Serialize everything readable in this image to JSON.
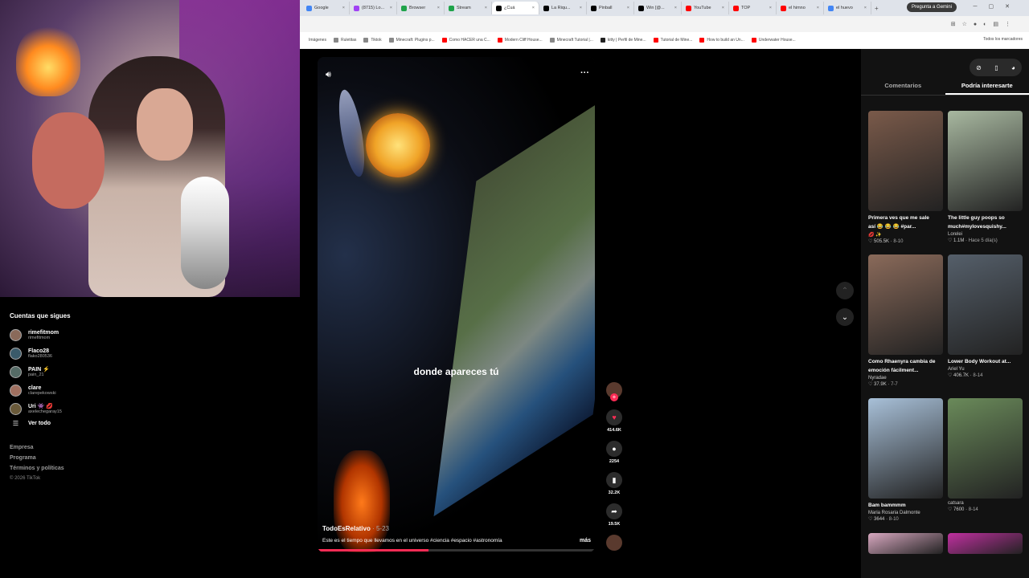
{
  "sidebar": {
    "following_title": "Cuentas que sigues",
    "following": [
      {
        "name": "rimefitmom",
        "handle": "rimefitmom",
        "color": "#8a6a5a"
      },
      {
        "name": "Flaco28",
        "handle": "flako280536",
        "color": "#3a5a6a"
      },
      {
        "name": "PAIN ⚡",
        "handle": "pain_21",
        "color": "#556b66"
      },
      {
        "name": "clare",
        "handle": "clarepekowski",
        "color": "#a07060"
      },
      {
        "name": "Uri 👾 💋",
        "handle": "axelechegaray15",
        "color": "#6a5a3a"
      }
    ],
    "see_all": "Ver todo",
    "links": [
      "Empresa",
      "Programa",
      "Términos y políticas"
    ],
    "copyright": "© 2026 TikTok"
  },
  "browser": {
    "tabs": [
      {
        "label": "Google",
        "color": "#4285f4"
      },
      {
        "label": "(8715) Lo...",
        "color": "#a142f4"
      },
      {
        "label": "Browser",
        "color": "#1fa34a"
      },
      {
        "label": "Stream",
        "color": "#1fa34a"
      },
      {
        "label": "¿Cuá",
        "color": "#000000"
      },
      {
        "label": "La Riqu...",
        "color": "#000000"
      },
      {
        "label": "Pinball",
        "color": "#000000"
      },
      {
        "label": "Win [@...",
        "color": "#000000"
      },
      {
        "label": "YouTube",
        "color": "#ff0000"
      },
      {
        "label": "TOP",
        "color": "#ff0000"
      },
      {
        "label": "el himno",
        "color": "#ff0000"
      },
      {
        "label": "el huevo",
        "color": "#4285f4"
      }
    ],
    "gemini_button": "Pregunta a Gemini",
    "bookmarks": [
      {
        "label": "Imágenes",
        "color": "#ffffff"
      },
      {
        "label": "Ruletitas",
        "color": "#888888"
      },
      {
        "label": "Tiktok",
        "color": "#888888"
      },
      {
        "label": "Minecraft: Plugins p...",
        "color": "#888888"
      },
      {
        "label": "Como HACER una C...",
        "color": "#ff0000"
      },
      {
        "label": "Modern Cliff House...",
        "color": "#ff0000"
      },
      {
        "label": "Minecraft Tutorial |...",
        "color": "#888888"
      },
      {
        "label": "kitty | Perfil de Mine...",
        "color": "#222222"
      },
      {
        "label": "Tutorial de Mine...",
        "color": "#ff0000"
      },
      {
        "label": "How to build an Un...",
        "color": "#ff0000"
      },
      {
        "label": "Underwater House...",
        "color": "#ff0000"
      }
    ],
    "all_bookmarks": "Todos los marcadores"
  },
  "video": {
    "caption": "donde apareces tú",
    "author": "TodoEsRelativo",
    "date": "· 5-23",
    "description": "Este es el tiempo que llevamos en el universo #ciencia #espacio #astronomía",
    "more": "más",
    "progress": 0.4,
    "likes": "414.6K",
    "comments": "2254",
    "saves": "32.2K",
    "shares": "19.5K"
  },
  "right_panel": {
    "tabs": [
      "Comentarios",
      "Podría interesarte"
    ],
    "active_tab": 1,
    "cards": [
      {
        "title": "Primera ves que me sale así 😂 😂 😂 #par...",
        "author": "💋 ✨",
        "views": "505.5K",
        "date": "8-10",
        "color": "#7a5a4a"
      },
      {
        "title": "The little guy poops so much#mylovesquishy...",
        "author": "Lorelei",
        "views": "1.1M",
        "date": "Hace 5 día(s)",
        "color": "#a8b8a0"
      },
      {
        "title": "Como Rhaenyra cambia de emoción fácilment...",
        "author": "Nyradae",
        "views": "37.9K",
        "date": "7-7",
        "color": "#8a6a5a"
      },
      {
        "title": "Lower Body Workout at...",
        "author": "Ariel Yu",
        "views": "406.7K",
        "date": "8-14",
        "color": "#555f6a"
      },
      {
        "title": "Bam bammmm",
        "author": "Maria Rosaria Dalmonte",
        "views": "3644",
        "date": "8-10",
        "color": "#a8c0d8"
      },
      {
        "title": "",
        "author": "catsara",
        "views": "7600",
        "date": "8-14",
        "color": "#6a8a5a"
      },
      {
        "title": "",
        "author": "",
        "views": "",
        "date": "",
        "color": "#d8a8c0"
      },
      {
        "title": "",
        "author": "",
        "views": "",
        "date": "",
        "color": "#c030a0"
      }
    ]
  }
}
